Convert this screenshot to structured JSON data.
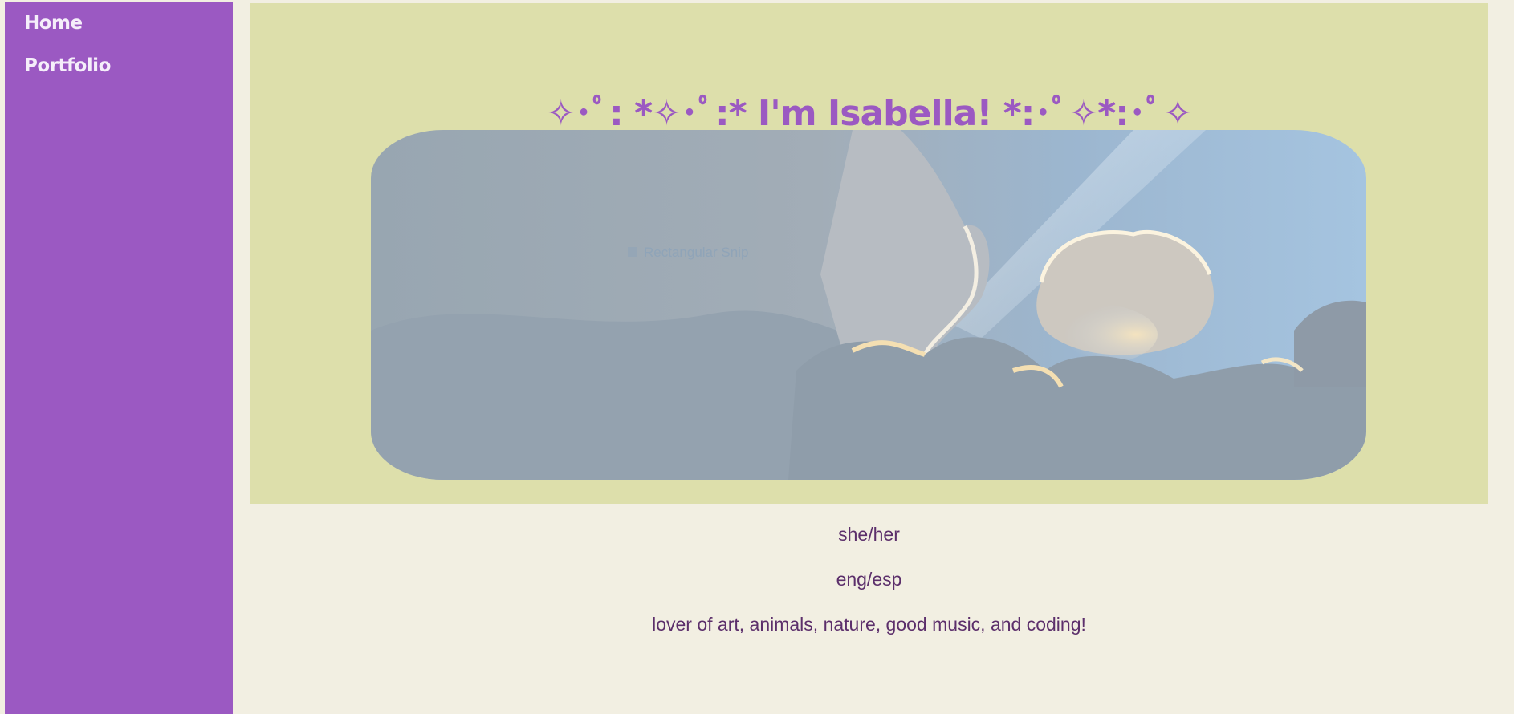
{
  "nav": {
    "items": [
      {
        "label": "Home"
      },
      {
        "label": "Portfolio"
      }
    ]
  },
  "hero": {
    "title": "✧･ﾟ: *✧･ﾟ:* I'm Isabella! *:･ﾟ✧*:･ﾟ✧",
    "image": {
      "kind": "cloudy-sky-photo",
      "overlay_text": "Rectangular Snip"
    }
  },
  "about": {
    "pronouns": "she/her",
    "languages": "eng/esp",
    "bio": "lover of art, animals, nature, good music, and coding!"
  },
  "colors": {
    "sidebar": "#9b59c2",
    "hero_bg": "#dddfab",
    "page_bg": "#f2efe2",
    "title": "#9b59c2",
    "body_text": "#5c2f6b"
  }
}
